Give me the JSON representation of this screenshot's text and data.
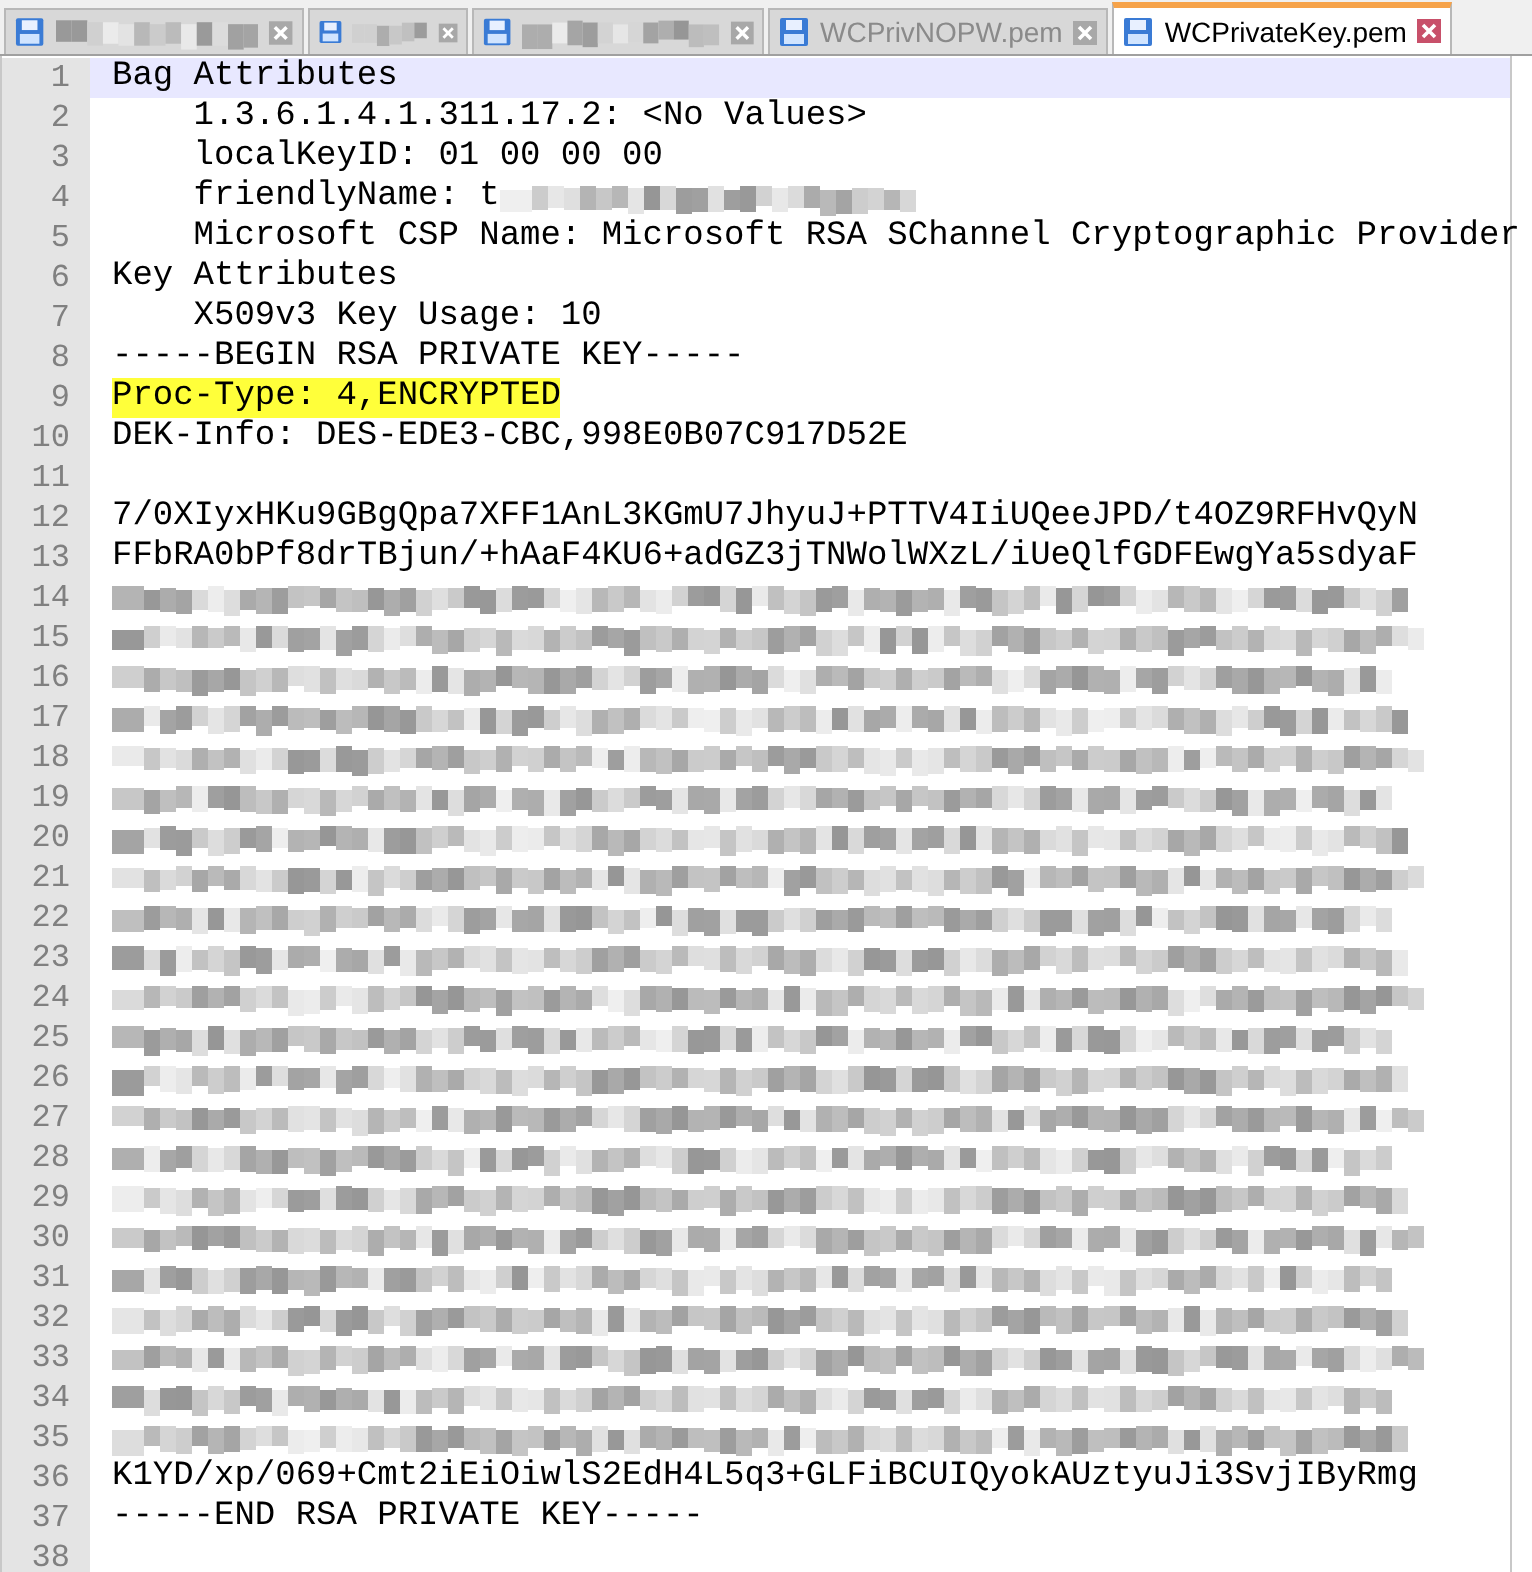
{
  "tabs": [
    {
      "kind": "redacted",
      "selected": false
    },
    {
      "kind": "redacted",
      "selected": false
    },
    {
      "kind": "redacted",
      "selected": false
    },
    {
      "kind": "file",
      "title": "WCPrivNOPW.pem",
      "selected": false
    },
    {
      "kind": "file",
      "title": "WCPrivateKey.pem",
      "selected": true
    }
  ],
  "editor": {
    "lines": [
      {
        "number": "1",
        "kind": "text",
        "text": "Bag Attributes",
        "current": true
      },
      {
        "number": "2",
        "kind": "text",
        "text": "    1.3.6.1.4.1.311.17.2: <No Values>"
      },
      {
        "number": "3",
        "kind": "text",
        "text": "    localKeyID: 01 00 00 00"
      },
      {
        "number": "4",
        "kind": "partly_redacted",
        "text": "    friendlyName: t"
      },
      {
        "number": "5",
        "kind": "text",
        "text": "    Microsoft CSP Name: Microsoft RSA SChannel Cryptographic Provider"
      },
      {
        "number": "6",
        "kind": "text",
        "text": "Key Attributes"
      },
      {
        "number": "7",
        "kind": "text",
        "text": "    X509v3 Key Usage: 10"
      },
      {
        "number": "8",
        "kind": "text",
        "text": "-----BEGIN RSA PRIVATE KEY-----"
      },
      {
        "number": "9",
        "kind": "text",
        "text": "Proc-Type: 4,ENCRYPTED",
        "highlighted": true
      },
      {
        "number": "10",
        "kind": "text",
        "text": "DEK-Info: DES-EDE3-CBC,998E0B07C917D52E"
      },
      {
        "number": "11",
        "kind": "text"
      },
      {
        "number": "12",
        "kind": "text",
        "text": "7/0XIyxHKu9GBgQpa7XFF1AnL3KGmU7JhyuJ+PTTV4IiUQeeJPD/t4OZ9RFHvQyN"
      },
      {
        "number": "13",
        "kind": "text",
        "text": "FFbRA0bPf8drTBjun/+hAaF4KU6+adGZ3jTNWolWXzL/iUeQlfGDFEwgYa5sdyaF"
      },
      {
        "number": "14",
        "kind": "redacted"
      },
      {
        "number": "15",
        "kind": "redacted"
      },
      {
        "number": "16",
        "kind": "redacted"
      },
      {
        "number": "17",
        "kind": "redacted"
      },
      {
        "number": "18",
        "kind": "redacted"
      },
      {
        "number": "19",
        "kind": "redacted"
      },
      {
        "number": "20",
        "kind": "redacted"
      },
      {
        "number": "21",
        "kind": "redacted"
      },
      {
        "number": "22",
        "kind": "redacted"
      },
      {
        "number": "23",
        "kind": "redacted"
      },
      {
        "number": "24",
        "kind": "redacted"
      },
      {
        "number": "25",
        "kind": "redacted"
      },
      {
        "number": "26",
        "kind": "redacted"
      },
      {
        "number": "27",
        "kind": "redacted"
      },
      {
        "number": "28",
        "kind": "redacted"
      },
      {
        "number": "29",
        "kind": "redacted"
      },
      {
        "number": "30",
        "kind": "redacted"
      },
      {
        "number": "31",
        "kind": "redacted"
      },
      {
        "number": "32",
        "kind": "redacted"
      },
      {
        "number": "33",
        "kind": "redacted"
      },
      {
        "number": "34",
        "kind": "redacted"
      },
      {
        "number": "35",
        "kind": "redacted"
      },
      {
        "number": "36",
        "kind": "text",
        "text": "K1YD/xp/069+Cmt2iEiOiwlS2EdH4L5q3+GLFiBCUIQyokAUztyuJi3SvjIByRmg"
      },
      {
        "number": "37",
        "kind": "text",
        "text": "-----END RSA PRIVATE KEY-----"
      },
      {
        "number": "38",
        "kind": "text"
      }
    ]
  }
}
